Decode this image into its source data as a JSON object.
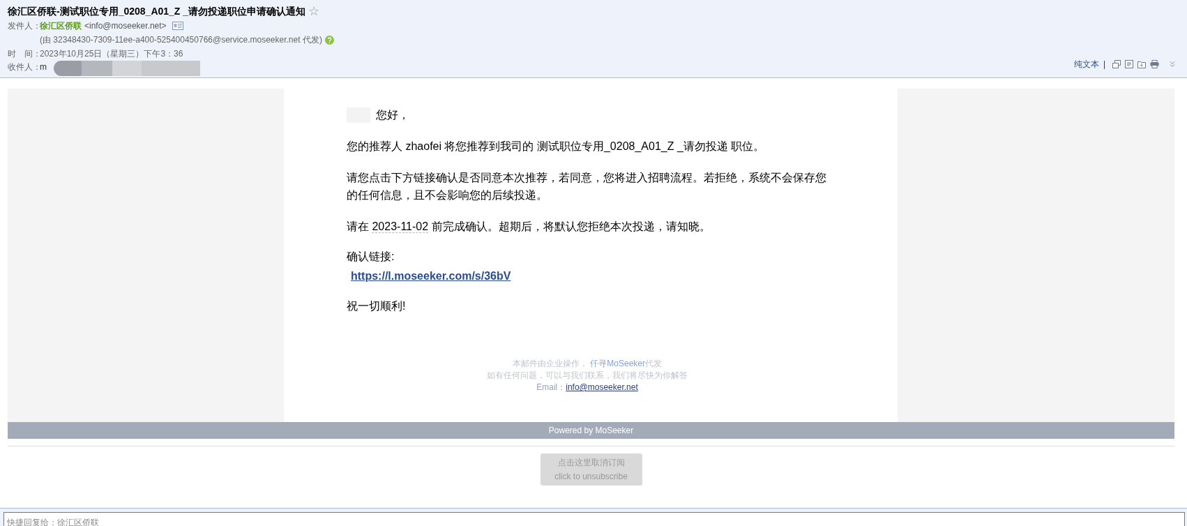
{
  "subject": {
    "title": "徐汇区侨联-测试职位专用_0208_A01_Z _请勿投递职位申请确认通知",
    "star": "☆"
  },
  "sender": {
    "label": "发件人：",
    "name": "徐汇区侨联",
    "address": "<info@moseeker.net>",
    "via": "(由 32348430-7309-11ee-a400-525400450766@service.moseeker.net 代发)"
  },
  "time": {
    "label": "时　间：",
    "value": "2023年10月25日（星期三）下午3：36"
  },
  "recipient": {
    "label": "收件人：",
    "value": "m"
  },
  "toolbar": {
    "plain_text": "纯文本",
    "separator": "|"
  },
  "body": {
    "greeting": "您好，",
    "paragraphs": [
      {
        "kind": "text",
        "text": "您的推荐人 zhaofei 将您推荐到我司的 测试职位专用_0208_A01_Z _请勿投递 职位。"
      },
      {
        "kind": "text",
        "text": "请您点击下方链接确认是否同意本次推荐，若同意，您将进入招聘流程。若拒绝，系统不会保存您的任何信息，且不会影响您的后续投递。"
      },
      {
        "kind": "date",
        "before": "请在 ",
        "date": "2023-11-02",
        "after": " 前完成确认。超期后，将默认您拒绝本次投递，请知晓。"
      }
    ],
    "link_label": "确认链接:",
    "link": "https://l.moseeker.com/s/36bV",
    "closing": "祝一切顺利!"
  },
  "footer": {
    "line1": "本邮件由企业操作，",
    "brand": "仟寻MoSeeker",
    "brand_suffix": "代发",
    "line2": "如有任何问题，可以与我们联系，我们将尽快为你解答",
    "email_label": "Email：",
    "email": "info@moseeker.net"
  },
  "powered": "Powered by MoSeeker",
  "unsubscribe": {
    "line1": "点击这里取消订阅",
    "line2": "click to unsubscribe"
  },
  "quick_reply": {
    "placeholder": "快捷回复给：徐汇区侨联"
  }
}
